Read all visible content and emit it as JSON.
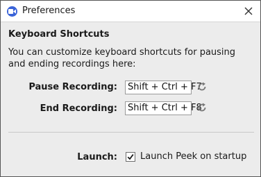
{
  "window": {
    "title": "Preferences",
    "app_icon": "video-camera-icon",
    "close_icon": "close-icon"
  },
  "shortcuts_section": {
    "heading": "Keyboard Shortcuts",
    "description": "You can customize keyboard shortcuts for pausing and ending recordings here:",
    "pause": {
      "label": "Pause Recording:",
      "value": "Shift + Ctrl + F7",
      "reset_icon": "reset-icon"
    },
    "end": {
      "label": "End Recording:",
      "value": "Shift + Ctrl + F8",
      "reset_icon": "reset-icon"
    }
  },
  "launch_section": {
    "label": "Launch:",
    "checkbox_label": "Launch Peek on startup",
    "checked": true
  },
  "colors": {
    "accent": "#3a63d8",
    "background": "#ececec",
    "titlebar": "#ffffff"
  }
}
